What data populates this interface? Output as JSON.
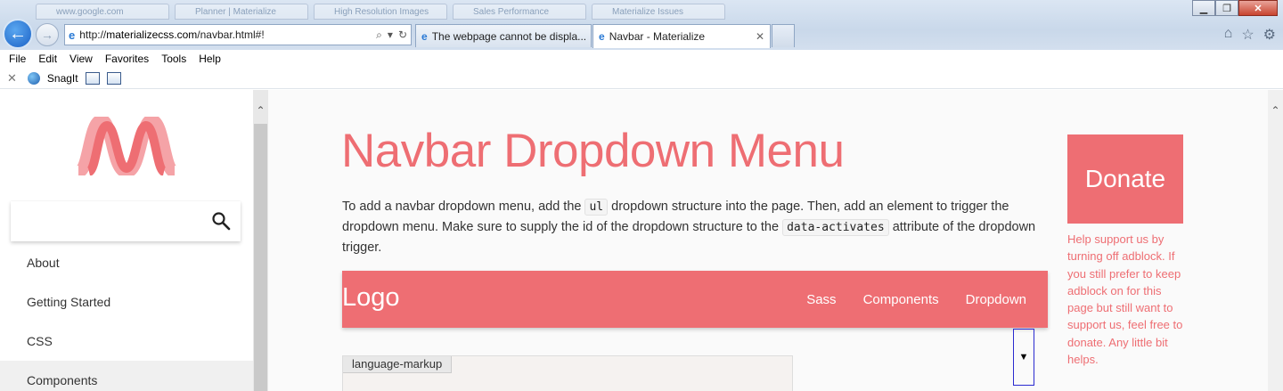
{
  "browser": {
    "ghost_tabs": [
      "www.google.com",
      "Planner | Materialize",
      "High Resolution Images",
      "Sales Performance",
      "Materialize Issues"
    ],
    "address": {
      "scheme": "http://",
      "host": "materializecss.com",
      "path": "/navbar.html#!"
    },
    "tabs": [
      {
        "label": "The webpage cannot be displa..."
      },
      {
        "label": "Navbar - Materialize",
        "close": "✕"
      }
    ],
    "window_controls": {
      "minimize": "▁",
      "maximize": "❐",
      "close": "✕"
    },
    "menu": [
      "File",
      "Edit",
      "View",
      "Favorites",
      "Tools",
      "Help"
    ],
    "toolbar": {
      "close": "✕",
      "snagit": "SnagIt"
    },
    "icons": {
      "home": "⌂",
      "star": "☆",
      "settings": "⚙"
    }
  },
  "sidebar": {
    "items": [
      "About",
      "Getting Started",
      "CSS",
      "Components"
    ],
    "search_placeholder": ""
  },
  "main": {
    "title": "Navbar Dropdown Menu",
    "para_1": "To add a navbar dropdown menu, add the ",
    "code_1": "ul",
    "para_2": " dropdown structure into the page. Then, add an element to trigger the dropdown menu. Make sure to supply the id of the dropdown structure to the ",
    "code_2": "data-activates",
    "para_3": " attribute of the dropdown trigger.",
    "demo_navbar": {
      "logo": "Logo",
      "links": [
        "Sass",
        "Components",
        "Dropdown"
      ],
      "dropdown_arrow": "▼"
    },
    "code_tag": "language-markup"
  },
  "donate": {
    "button": "Donate",
    "text": "Help support us by turning off adblock. If you still prefer to keep adblock on for this page but still want to support us, feel free to donate. Any little bit helps."
  },
  "colors": {
    "accent": "#ee6e73",
    "accent_light": "#f5a3a7"
  }
}
